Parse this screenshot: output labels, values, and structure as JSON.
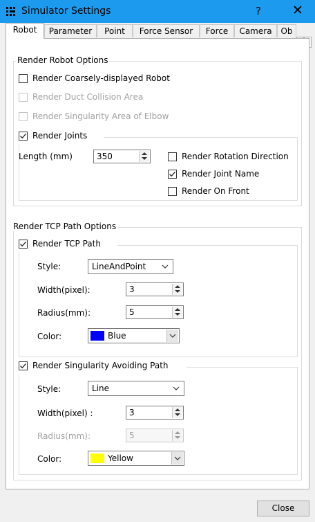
{
  "window": {
    "title": "Simulator Settings",
    "help_glyph": "?",
    "close_glyph": "✕"
  },
  "tabs": [
    "Robot",
    "Parameter",
    "Point",
    "Force Sensor",
    "Force",
    "Camera",
    "Ob"
  ],
  "robot_options": {
    "group_title": "Render Robot Options",
    "coarse": "Render Coarsely-displayed Robot",
    "duct": "Render Duct Collision Area",
    "singularity_elbow": "Render Singularity Area of Elbow",
    "joints": {
      "label": "Render Joints",
      "checked": true,
      "length_label": "Length (mm)",
      "length_value": "350",
      "rotation_direction": "Render Rotation Direction",
      "joint_name": "Render Joint Name",
      "on_front": "Render On Front"
    }
  },
  "tcp_options": {
    "group_title": "Render TCP Path Options",
    "tcp_path": {
      "label": "Render TCP Path",
      "checked": true,
      "style_label": "Style:",
      "style_value": "LineAndPoint",
      "width_label": "Width(pixel):",
      "width_value": "3",
      "radius_label": "Radius(mm):",
      "radius_value": "5",
      "color_label": "Color:",
      "color_value": "Blue",
      "color_hex": "#0000ff"
    },
    "singularity_path": {
      "label": "Render Singularity Avoiding Path",
      "checked": true,
      "style_label": "Style:",
      "style_value": "Line",
      "width_label": "Width(pixel) :",
      "width_value": "3",
      "radius_label": "Radius(mm):",
      "radius_value": "5",
      "color_label": "Color:",
      "color_value": "Yellow",
      "color_hex": "#ffff00"
    }
  },
  "footer": {
    "close_label": "Close"
  },
  "colors": {
    "titlebar": "#1b9aee"
  }
}
